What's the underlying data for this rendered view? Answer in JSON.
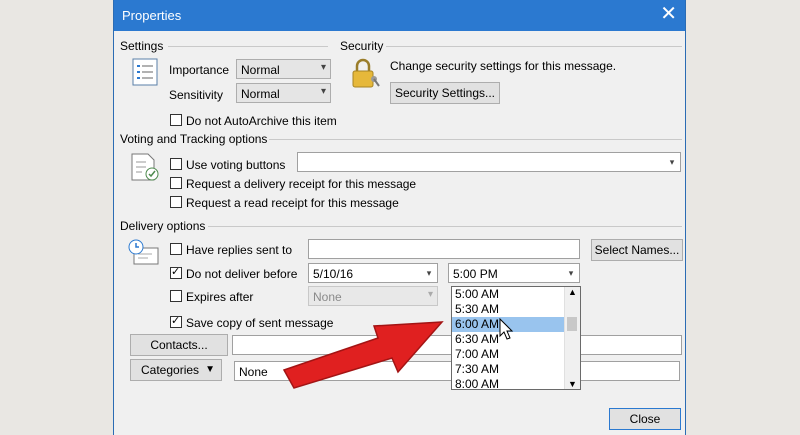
{
  "window": {
    "title": "Properties",
    "close_glyph": "✕"
  },
  "settings": {
    "heading": "Settings",
    "importance_label": "Importance",
    "importance_value": "Normal",
    "sensitivity_label": "Sensitivity",
    "sensitivity_value": "Normal",
    "autoarchive_label": "Do not AutoArchive this item"
  },
  "security": {
    "heading": "Security",
    "description": "Change security settings for this message.",
    "button_label": "Security Settings..."
  },
  "voting": {
    "heading": "Voting and Tracking options",
    "use_voting_label": "Use voting buttons",
    "delivery_receipt_label": "Request a delivery receipt for this message",
    "read_receipt_label": "Request a read receipt for this message"
  },
  "delivery": {
    "heading": "Delivery options",
    "have_replies_label": "Have replies sent to",
    "select_names_label": "Select Names...",
    "do_not_deliver_label": "Do not deliver before",
    "date_value": "5/10/16",
    "time_value": "5:00 PM",
    "expires_label": "Expires after",
    "expires_value": "None",
    "save_copy_label": "Save copy of sent message",
    "time_options": [
      "5:00 AM",
      "5:30 AM",
      "6:00 AM",
      "6:30 AM",
      "7:00 AM",
      "7:30 AM",
      "8:00 AM"
    ],
    "selected_time_option": "6:00 AM"
  },
  "contacts": {
    "button_label": "Contacts..."
  },
  "categories": {
    "button_label": "Categories",
    "value": "None"
  },
  "footer": {
    "close_label": "Close"
  },
  "colors": {
    "title_bar": "#2b79d0",
    "selected_item": "#99c4ee",
    "arrow": "#e02020"
  }
}
